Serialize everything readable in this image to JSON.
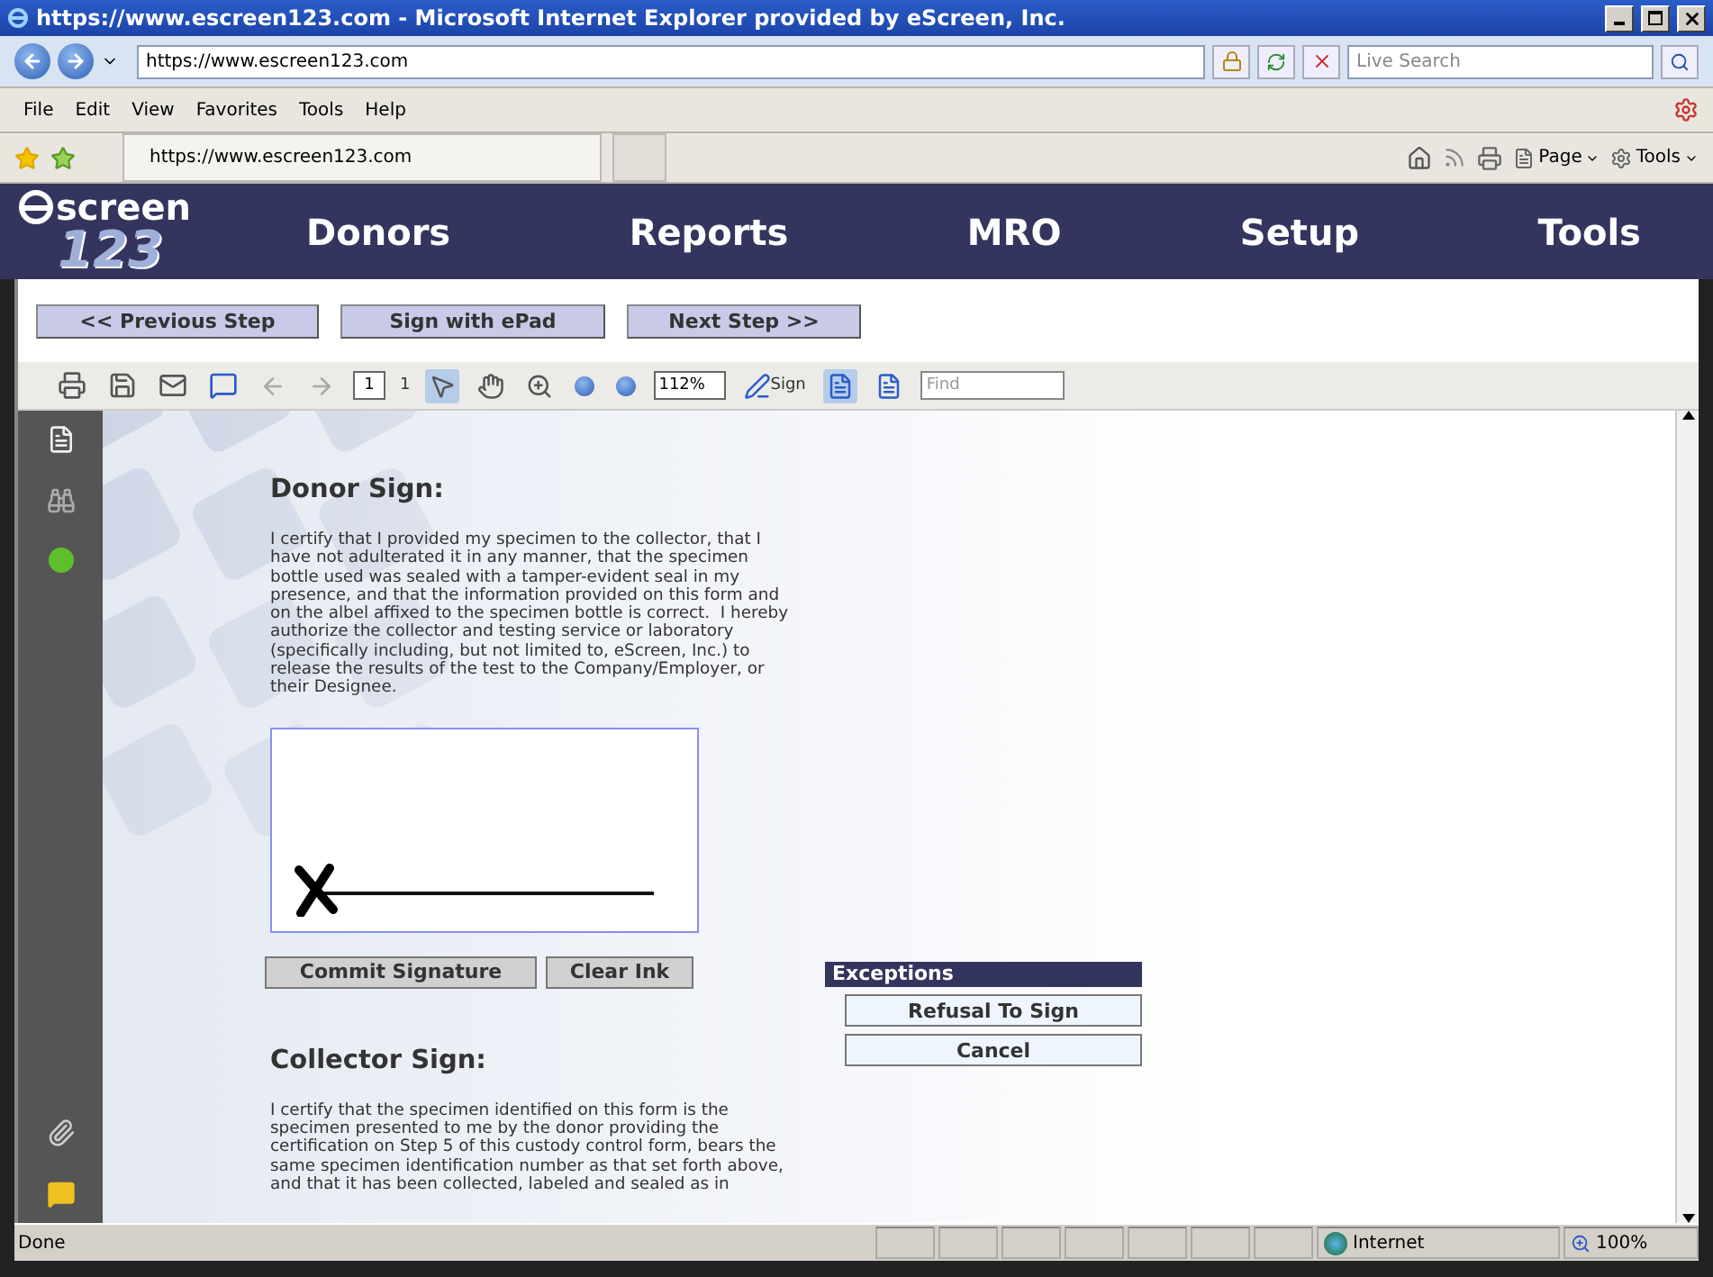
{
  "window": {
    "title": "https://www.escreen123.com - Microsoft Internet Explorer provided by eScreen, Inc."
  },
  "address_bar": {
    "url": "https://www.escreen123.com"
  },
  "search": {
    "placeholder": "Live Search"
  },
  "menu": [
    "File",
    "Edit",
    "View",
    "Favorites",
    "Tools",
    "Help"
  ],
  "favorites_tab": {
    "title": "https://www.escreen123.com"
  },
  "command_bar": [
    "Page",
    "Tools"
  ],
  "logo": {
    "word": "screen",
    "number": "123"
  },
  "nav": [
    "Donors",
    "Reports",
    "MRO",
    "Setup",
    "Tools"
  ],
  "step_buttons": [
    "<< Previous Step",
    "Sign with ePad",
    "Next Step >>"
  ],
  "pdf_toolbar": {
    "page": "1",
    "page_count": "1",
    "zoom": "112%",
    "sign": "Sign",
    "find_placeholder": "Find"
  },
  "donor": {
    "heading": "Donor Sign:",
    "lines": [
      "I certify that I provided my specimen to the collector, that I",
      "have not adulterated it in any manner, that the specimen",
      "bottle used was sealed with a tamper-evident seal in my",
      "presence, and that the information provided on this form and",
      "on the albel affixed to the specimen bottle is correct.  I hereby",
      "authorize the collector and testing service or laboratory",
      "(specifically including, but not limited to, eScreen, Inc.) to",
      "release the results of the test to the Company/Employer, or",
      "their Designee."
    ]
  },
  "signature_buttons": [
    "Commit Signature",
    "Clear Ink"
  ],
  "exceptions": {
    "title": "Exceptions",
    "buttons": [
      "Refusal To Sign",
      "Cancel"
    ]
  },
  "collector": {
    "heading": "Collector Sign:",
    "lines": [
      "I certify that the specimen identified on this form is the",
      "specimen presented to me by the donor providing the",
      "certification on Step 5 of this custody control form, bears the",
      "same specimen identification number as that set forth above,",
      "and that it has been collected, labeled and sealed as in"
    ]
  },
  "status_bar": {
    "text": "Done",
    "zone": "Internet",
    "zoom": "100%"
  }
}
